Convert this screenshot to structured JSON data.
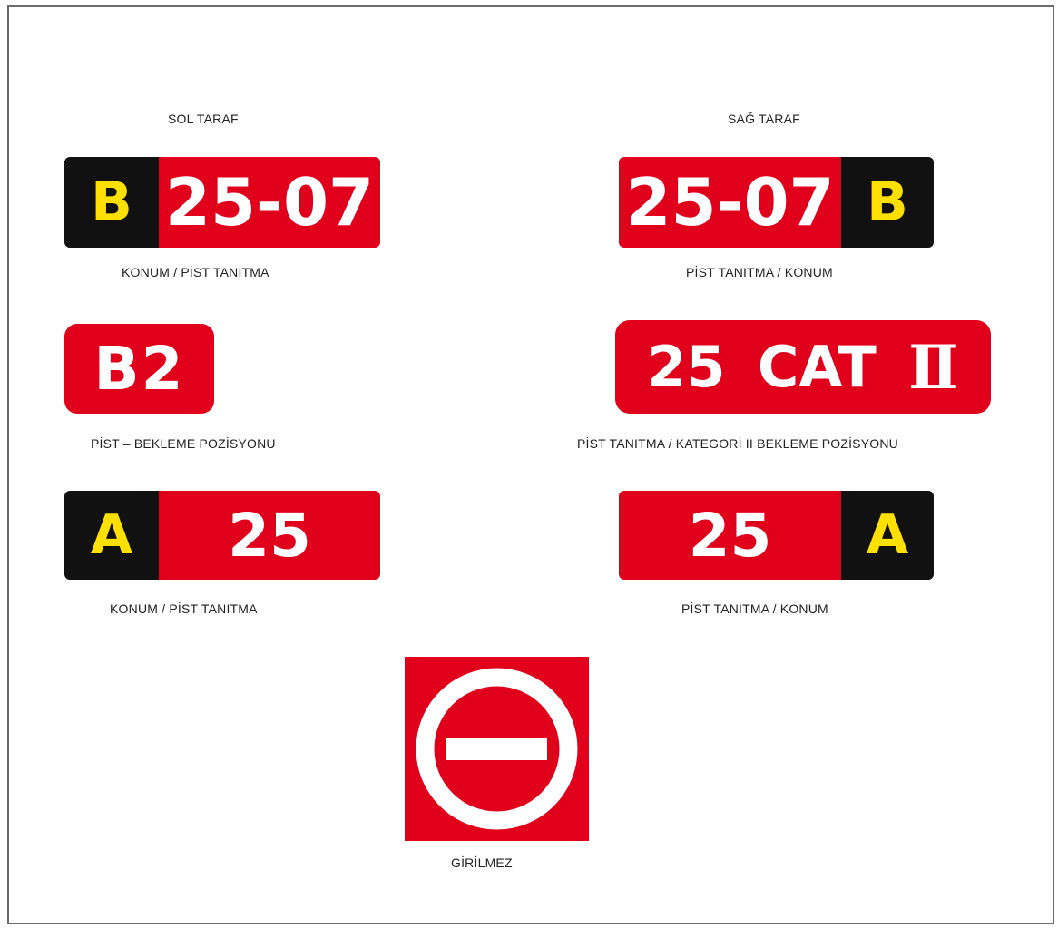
{
  "headers": {
    "left": "SOL TARAF",
    "right": "SAĞ TARAF"
  },
  "colors": {
    "red": "#e0001b",
    "black": "#111111",
    "yellow": "#ffe000",
    "white": "#ffffff"
  },
  "signs": {
    "row1_left": {
      "location": "B",
      "runway": "25-07",
      "caption": "KONUM / PİST TANITMA"
    },
    "row1_right": {
      "runway": "25-07",
      "location": "B",
      "caption": "PİST TANITMA / KONUM"
    },
    "row2_left": {
      "text": "B2",
      "caption": "PİST – BEKLEME POZİSYONU"
    },
    "row2_right": {
      "runway": "25",
      "category": "CAT",
      "numeral": "Ⅱ",
      "caption": "PİST TANITMA / KATEGORİ II BEKLEME POZİSYONU"
    },
    "row3_left": {
      "location": "A",
      "runway": "25",
      "caption": "KONUM / PİST TANITMA"
    },
    "row3_right": {
      "runway": "25",
      "location": "A",
      "caption": "PİST TANITMA / KONUM"
    },
    "no_entry": {
      "icon": "no-entry-icon",
      "caption": "GİRİLMEZ"
    }
  }
}
